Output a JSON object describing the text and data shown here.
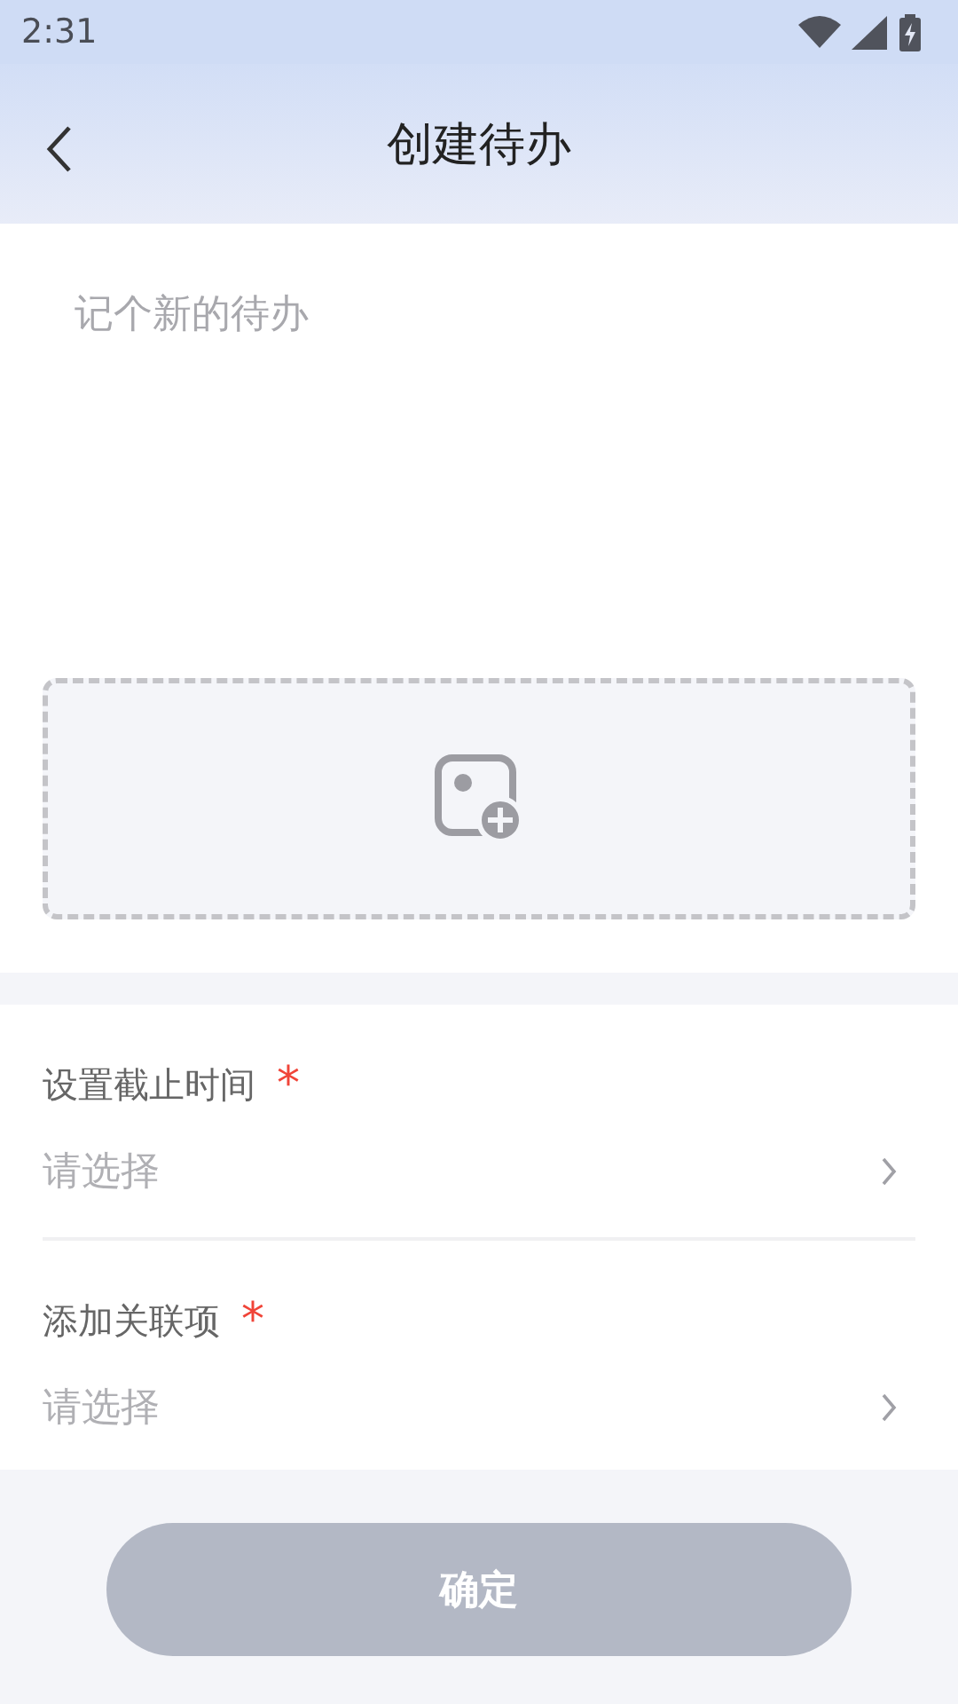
{
  "status_bar": {
    "time": "2:31"
  },
  "header": {
    "title": "创建待办"
  },
  "editor": {
    "placeholder": "记个新的待办"
  },
  "fields": [
    {
      "label": "设置截止时间",
      "required_mark": "*",
      "placeholder": "请选择"
    },
    {
      "label": "添加关联项",
      "required_mark": "*",
      "placeholder": "请选择"
    }
  ],
  "confirm_button": {
    "label": "确定",
    "disabled": true
  }
}
